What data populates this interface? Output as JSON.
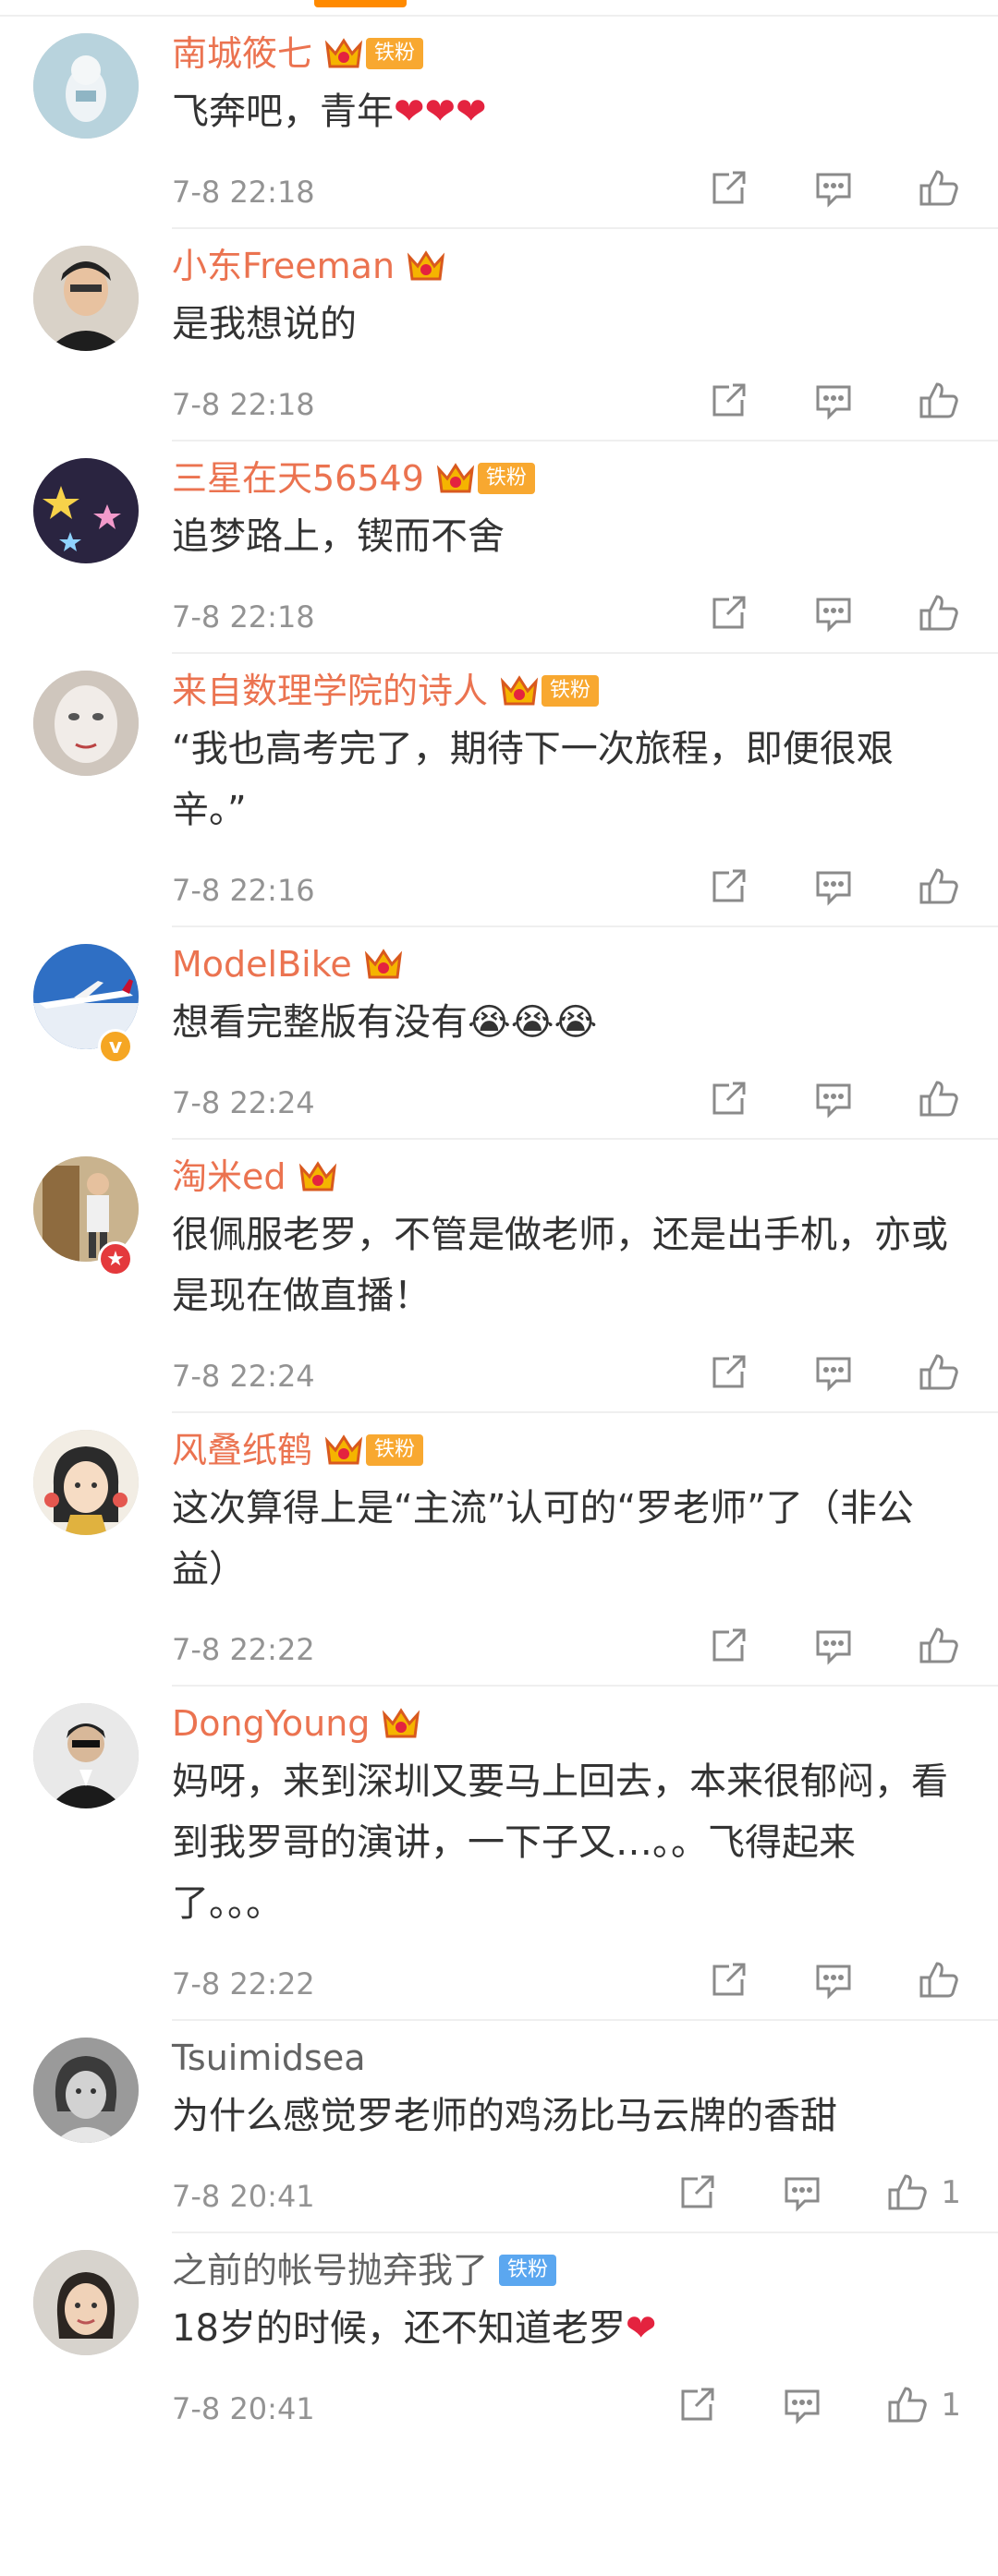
{
  "accent_color": "#eb7350",
  "icons": {
    "share": "share-icon",
    "reply": "comment-icon",
    "like": "thumbs-up-icon",
    "member": "crown-icon"
  },
  "comments": [
    {
      "user": "南城筱七",
      "text": "飞奔吧，青年",
      "emoji": "❤❤❤",
      "time": "7-8 22:18",
      "badge": "铁粉",
      "likes": ""
    },
    {
      "user": "小东Freeman",
      "text": "是我想说的",
      "time": "7-8 22:18",
      "likes": ""
    },
    {
      "user": "三星在天56549",
      "text": "追梦路上，锲而不舍",
      "time": "7-8 22:18",
      "badge": "铁粉",
      "likes": ""
    },
    {
      "user": "来自数理学院的诗人",
      "text": "“我也高考完了，期待下一次旅程，即便很艰辛。”",
      "time": "7-8 22:16",
      "badge": "铁粉",
      "likes": ""
    },
    {
      "user": "ModelBike",
      "text": "想看完整版有没有",
      "emoji": "😭😭😭",
      "time": "7-8 22:24",
      "likes": ""
    },
    {
      "user": "淘米ed",
      "text": "很佩服老罗，不管是做老师，还是出手机，亦或是现在做直播！",
      "time": "7-8 22:24",
      "likes": ""
    },
    {
      "user": "风叠纸鹤",
      "text": "这次算得上是“主流”认可的“罗老师”了（非公益）",
      "time": "7-8 22:22",
      "badge": "铁粉",
      "likes": ""
    },
    {
      "user": "DongYoung",
      "text": "妈呀，来到深圳又要马上回去，本来很郁闷，看到我罗哥的演讲，一下子又…。。飞得起来了。。。",
      "time": "7-8 22:22",
      "likes": ""
    },
    {
      "user": "Tsuimidsea",
      "text": "为什么感觉罗老师的鸡汤比马云牌的香甜",
      "time": "7-8 20:41",
      "likes": "1"
    },
    {
      "user": "之前的帐号抛弃我了",
      "text": "18岁的时候，还不知道老罗",
      "emoji": "❤",
      "time": "7-8 20:41",
      "badge": "铁粉",
      "likes": "1"
    }
  ]
}
